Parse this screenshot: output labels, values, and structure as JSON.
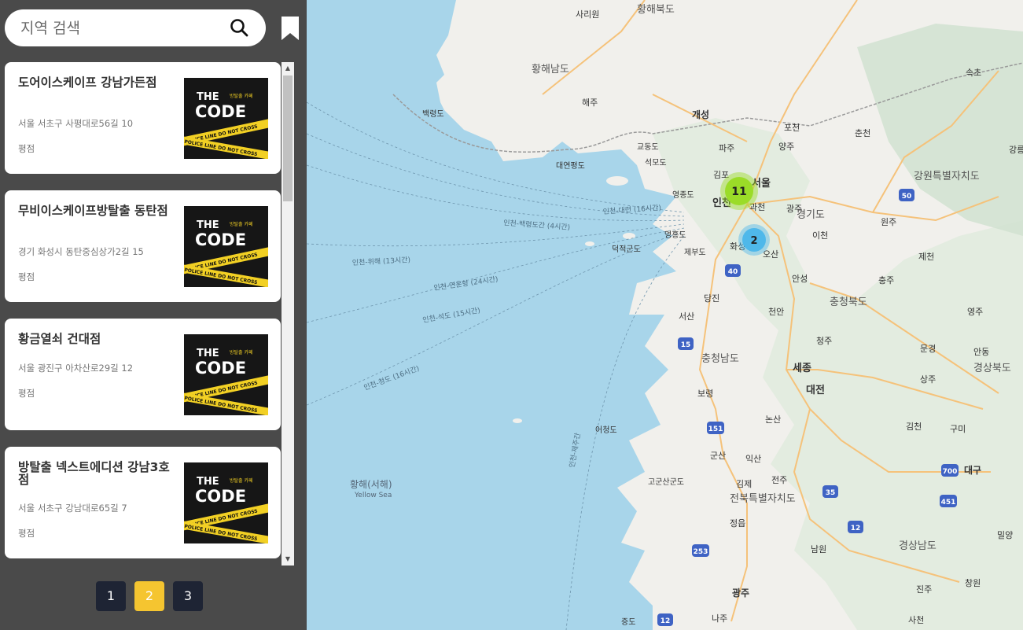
{
  "search": {
    "placeholder": "지역 검색"
  },
  "cards": [
    {
      "title": "도어이스케이프 강남가든점",
      "address": "서울 서초구 사평대로56길 10",
      "rating_label": "평점"
    },
    {
      "title": "무비이스케이프방탈출 동탄점",
      "address": "경기 화성시 동탄중심상가2길 15",
      "rating_label": "평점"
    },
    {
      "title": "황금열쇠 건대점",
      "address": "서울 광진구 아차산로29길 12",
      "rating_label": "평점"
    },
    {
      "title": "방탈출 넥스트에디션 강남3호점",
      "address": "서울 서초구 강남대로65길 7",
      "rating_label": "평점"
    }
  ],
  "thumbnail": {
    "logo_the": "THE",
    "logo_code": "CODE",
    "tagline": "방탈출 카페",
    "tape_text": "POLICE LINE DO NOT CROSS"
  },
  "pagination": {
    "pages": [
      "1",
      "2",
      "3"
    ],
    "active": "2"
  },
  "map": {
    "clusters": [
      {
        "count": "11",
        "color": "#9bdc28"
      },
      {
        "count": "2",
        "color": "#4fb8ea"
      }
    ],
    "places": {
      "sariwon": "사리원",
      "hwanghae_n": "황해북도",
      "hwanghae_s": "황해남도",
      "haeju": "해주",
      "gaeseong": "개성",
      "baengnyeong": "백령도",
      "pocheon": "포천",
      "chuncheon": "춘천",
      "sokcho": "속초",
      "gangneung": "강릉",
      "paju": "파주",
      "yangju": "양주",
      "gyodong": "교동도",
      "seongmo": "석모도",
      "yeonpyeong": "대연평도",
      "gimpo": "김포",
      "seoul": "서울",
      "gangwon": "강원특별자치도",
      "yeongjong": "영종도",
      "incheon": "인천",
      "gwacheon": "과천",
      "gwangju_gg": "광주",
      "gyeonggi": "경기도",
      "wonju": "원주",
      "yeongheung": "영흥도",
      "icheon": "이천",
      "jebudo": "제부도",
      "hwaseong": "화성",
      "osan": "오산",
      "deokjeok": "덕적군도",
      "jecheon": "제천",
      "anseong": "안성",
      "chungju": "충주",
      "dangjin": "당진",
      "chungbuk": "충청북도",
      "cheonan": "천안",
      "seosan": "서산",
      "yeongju": "영주",
      "cheongju": "청주",
      "chungnam": "충청남도",
      "sejong": "세종",
      "mungyeong": "문경",
      "andong": "안동",
      "gyeongbuk": "경상북도",
      "daejeon": "대전",
      "boryeong": "보령",
      "sangju": "상주",
      "nonsan": "논산",
      "gimcheon": "김천",
      "gumi": "구미",
      "eocheongdo": "어청도",
      "gunsan": "군산",
      "iksan": "익산",
      "daegu": "대구",
      "yellow_sea": "황해(서해)",
      "yellow_sea_en": "Yellow Sea",
      "gogunsan": "고군산군도",
      "gimje": "김제",
      "jeonju": "전주",
      "jeonbuk": "전북특별자치도",
      "jeongeup": "정읍",
      "miryang": "밀양",
      "namwon": "남원",
      "gyeongnam": "경상남도",
      "gwangju": "광주",
      "jinju": "진주",
      "changwon": "창원",
      "jeungdo": "증도",
      "naju": "나주",
      "sacheon": "사천",
      "ferry_daeyeon": "인천-대련 (16시간)",
      "ferry_baengnyeong": "인천-백령도간 (4시간)",
      "ferry_weihai": "인천-위해 (13시간)",
      "ferry_yeonungang": "인천-연운항 (24시간)",
      "ferry_shidao": "인천-석도 (15시간)",
      "ferry_qingdao": "인천-청도 (16시간)",
      "ferry_jeju": "인천-제주간"
    },
    "route_shields": [
      "50",
      "40",
      "15",
      "151",
      "35",
      "700",
      "451",
      "12",
      "253",
      "12"
    ]
  }
}
